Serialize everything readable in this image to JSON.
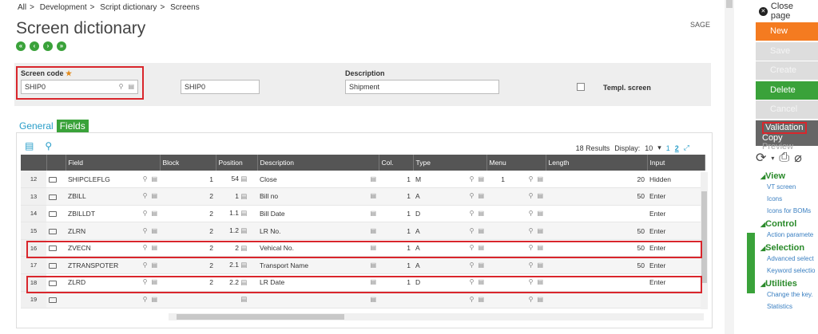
{
  "breadcrumb": {
    "items": [
      "All",
      "Development",
      "Script dictionary",
      "Screens"
    ],
    "sep": ">"
  },
  "page": {
    "title": "Screen dictionary",
    "company": "SAGE"
  },
  "header": {
    "screen_code_label": "Screen code",
    "screen_code_value": "SHIP0",
    "screen_code_display": "SHIP0",
    "description_label": "Description",
    "description_value": "Shipment",
    "templ_label": "Templ. screen"
  },
  "tabs": [
    "General",
    "Fields"
  ],
  "grid": {
    "results": "18 Results",
    "display_label": "Display:",
    "display_value": "10",
    "page1": "1",
    "page2": "2",
    "columns": [
      "",
      "",
      "Field",
      "Block",
      "Position",
      "Description",
      "Col.",
      "Type",
      "Menu",
      "Length",
      "Input"
    ],
    "rows": [
      {
        "n": "12",
        "field": "SHIPCLEFLG",
        "block": "1",
        "pos": "54",
        "desc": "Close",
        "col": "1",
        "type": "M",
        "menu": "1",
        "len": "20",
        "input": "Hidden"
      },
      {
        "n": "13",
        "field": "ZBILL",
        "block": "2",
        "pos": "1",
        "desc": "Bill no",
        "col": "1",
        "type": "A",
        "menu": "",
        "len": "50",
        "input": "Enter"
      },
      {
        "n": "14",
        "field": "ZBILLDT",
        "block": "2",
        "pos": "1.1",
        "desc": "Bill Date",
        "col": "1",
        "type": "D",
        "menu": "",
        "len": "",
        "input": "Enter"
      },
      {
        "n": "15",
        "field": "ZLRN",
        "block": "2",
        "pos": "1.2",
        "desc": "LR No.",
        "col": "1",
        "type": "A",
        "menu": "",
        "len": "50",
        "input": "Enter"
      },
      {
        "n": "16",
        "field": "ZVECN",
        "block": "2",
        "pos": "2",
        "desc": "Vehical No.",
        "col": "1",
        "type": "A",
        "menu": "",
        "len": "50",
        "input": "Enter"
      },
      {
        "n": "17",
        "field": "ZTRANSPOTER",
        "block": "2",
        "pos": "2.1",
        "desc": "Transport Name",
        "col": "1",
        "type": "A",
        "menu": "",
        "len": "50",
        "input": "Enter"
      },
      {
        "n": "18",
        "field": "ZLRD",
        "block": "2",
        "pos": "2.2",
        "desc": "LR Date",
        "col": "1",
        "type": "D",
        "menu": "",
        "len": "",
        "input": "Enter"
      },
      {
        "n": "19",
        "field": "",
        "block": "",
        "pos": "",
        "desc": "",
        "col": "",
        "type": "",
        "menu": "",
        "len": "",
        "input": ""
      }
    ]
  },
  "sidebar": {
    "close_label": "Close page",
    "buttons": {
      "new": "New",
      "save": "Save",
      "create": "Create",
      "delete": "Delete",
      "cancel": "Cancel",
      "validation": "Validation",
      "copy": "Copy",
      "preview": "Preview"
    },
    "sections": [
      {
        "title": "View",
        "items": [
          "VT screen",
          "Icons",
          "Icons for BOMs"
        ]
      },
      {
        "title": "Control",
        "items": [
          "Action paramete"
        ]
      },
      {
        "title": "Selection",
        "items": [
          "Advanced select",
          "Keyword selectio"
        ]
      },
      {
        "title": "Utilities",
        "items": [
          "Change the key.",
          "Statistics"
        ]
      }
    ]
  },
  "colors": {
    "green": "#3aa23a",
    "orange": "#f47b20",
    "red": "#d9262c",
    "link": "#2a9ec9"
  }
}
